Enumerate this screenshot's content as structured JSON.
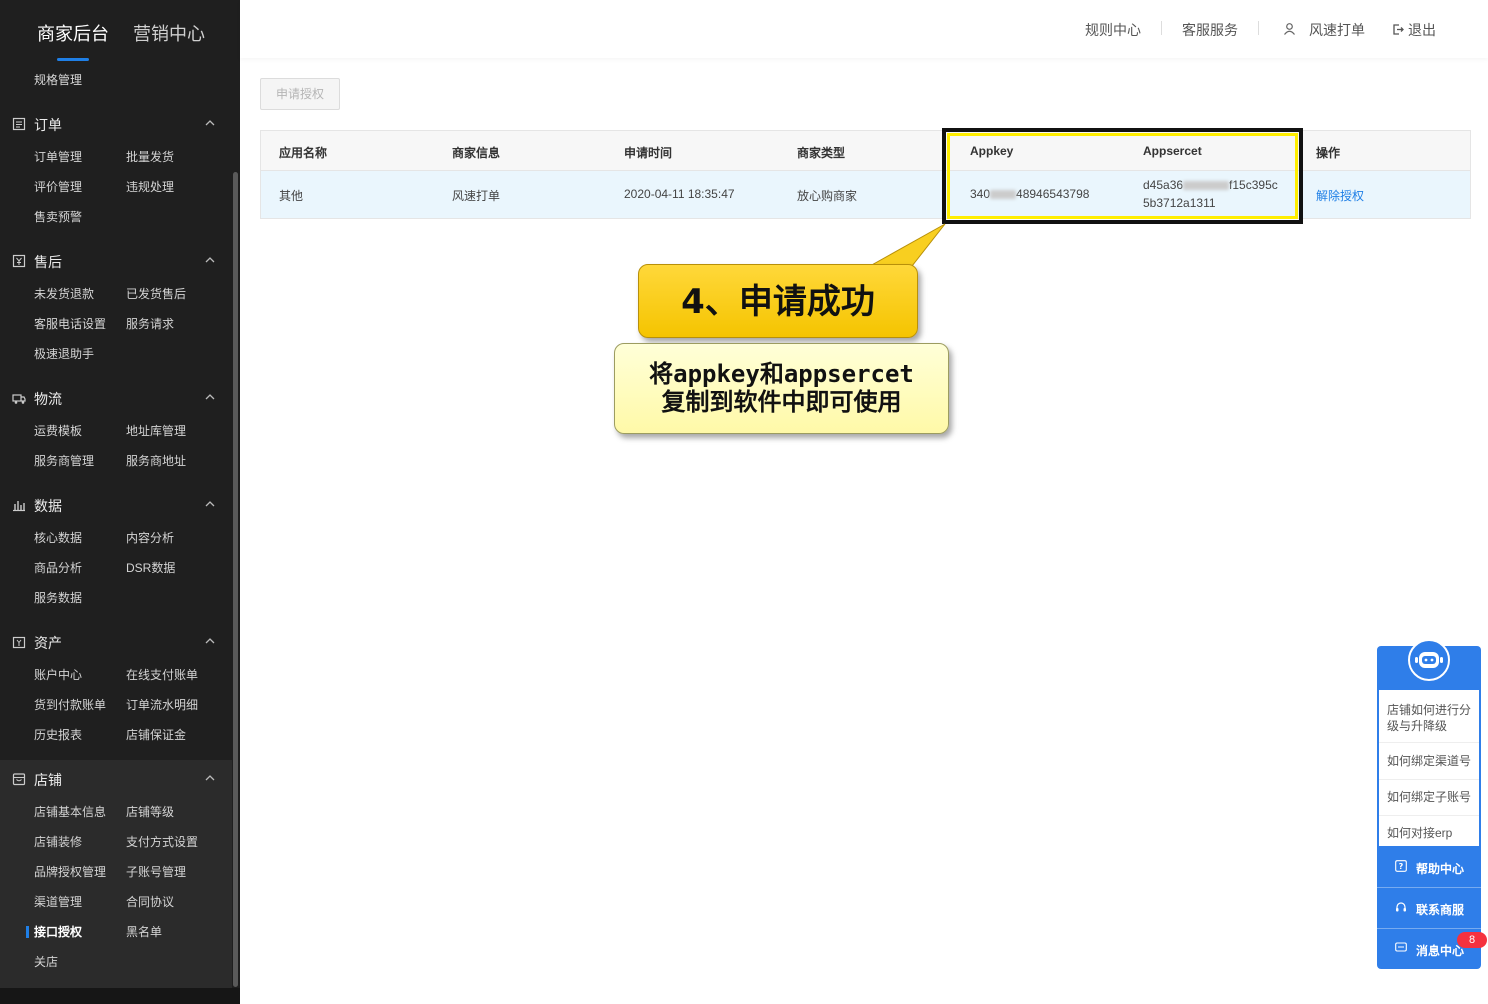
{
  "sidebar": {
    "tabs": {
      "merchant": "商家后台",
      "marketing": "营销中心"
    },
    "partial_item": "规格管理",
    "sections": {
      "order": {
        "title": "订单",
        "items": [
          "订单管理",
          "批量发货",
          "评价管理",
          "违规处理",
          "售卖预警"
        ]
      },
      "aftersale": {
        "title": "售后",
        "items": [
          "未发货退款",
          "已发货售后",
          "客服电话设置",
          "服务请求",
          "极速退助手"
        ]
      },
      "logistics": {
        "title": "物流",
        "items": [
          "运费模板",
          "地址库管理",
          "服务商管理",
          "服务商地址"
        ]
      },
      "data": {
        "title": "数据",
        "items": [
          "核心数据",
          "内容分析",
          "商品分析",
          "DSR数据",
          "服务数据"
        ]
      },
      "assets": {
        "title": "资产",
        "items": [
          "账户中心",
          "在线支付账单",
          "货到付款账单",
          "订单流水明细",
          "历史报表",
          "店铺保证金"
        ]
      },
      "shop": {
        "title": "店铺",
        "items": [
          "店铺基本信息",
          "店铺等级",
          "店铺装修",
          "支付方式设置",
          "品牌授权管理",
          "子账号管理",
          "渠道管理",
          "合同协议",
          "接口授权",
          "黑名单",
          "关店"
        ]
      }
    }
  },
  "header": {
    "rules": "规则中心",
    "service": "客服服务",
    "user": "风速打单",
    "logout": "退出"
  },
  "content": {
    "apply_button": "申请授权",
    "table": {
      "headers": [
        "应用名称",
        "商家信息",
        "申请时间",
        "商家类型",
        "Appkey",
        "Appsercet",
        "操作"
      ],
      "row": {
        "app_name": "其他",
        "merchant": "风速打单",
        "time": "2020-04-11 18:35:47",
        "type": "放心购商家",
        "appkey_start": "340",
        "appkey_end": "48946543798",
        "secret_start": "d45a36",
        "secret_mid": "f15c395c",
        "secret_line2": "5b3712a1311",
        "action": "解除授权"
      }
    }
  },
  "callout": {
    "title": "4、申请成功",
    "line1": "将appkey和appsercet",
    "line2": "复制到软件中即可使用"
  },
  "help": {
    "questions": [
      "店铺如何进行分级与升降级",
      "如何绑定渠道号",
      "如何绑定子账号",
      "如何对接erp"
    ],
    "help_center": "帮助中心",
    "contact": "联系商服",
    "messages": "消息中心",
    "badge": "8"
  },
  "colors": {
    "accent": "#1f7fe6",
    "sidebar_bg": "#1f1f1f",
    "widget_bg": "#2f7ee9",
    "highlight": "#ffee00"
  }
}
